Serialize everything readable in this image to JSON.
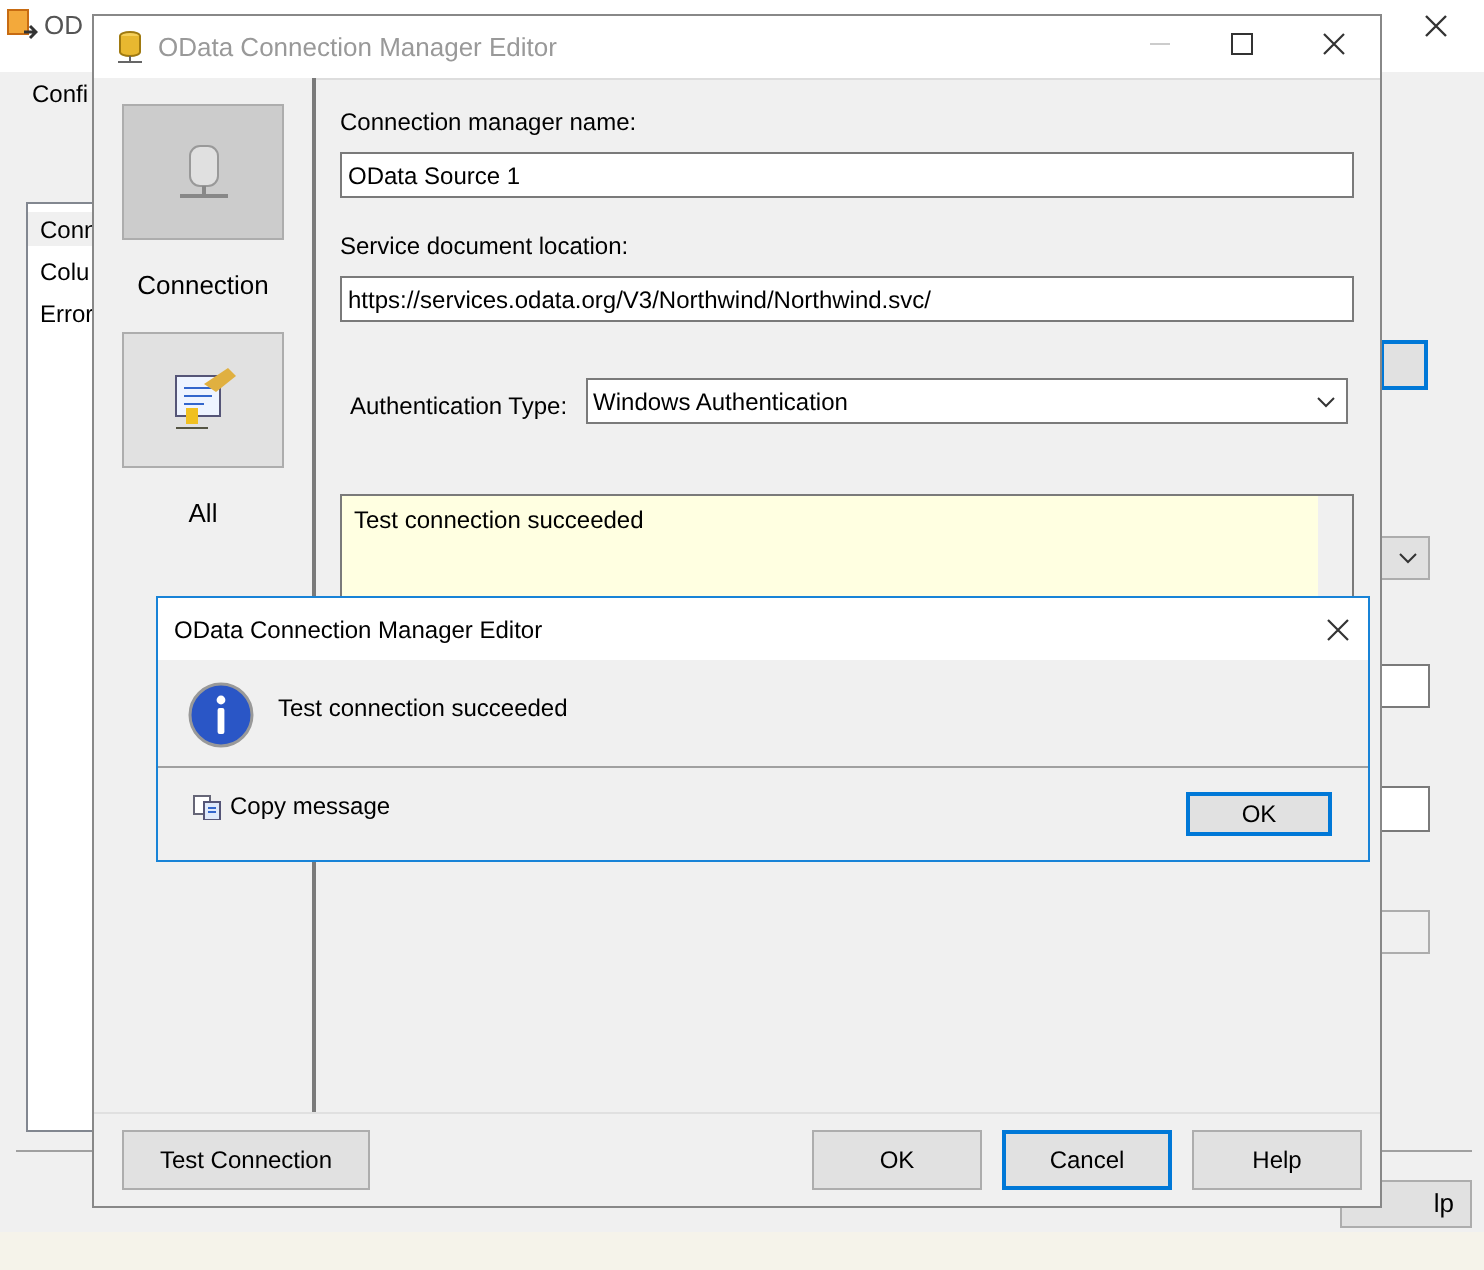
{
  "background_window": {
    "title": "OD",
    "section_label": "Confi",
    "list_items": [
      {
        "label": "Conn",
        "selected": true
      },
      {
        "label": "Colu",
        "selected": false
      },
      {
        "label": "Error",
        "selected": false
      }
    ],
    "help_button": "lp"
  },
  "editor": {
    "title": "OData Connection Manager Editor",
    "pages": [
      {
        "label": "Connection",
        "selected": true
      },
      {
        "label": "All",
        "selected": false
      }
    ],
    "connection_manager_name": {
      "label": "Connection manager name:",
      "value": "OData Source 1"
    },
    "service_document_location": {
      "label": "Service document location:",
      "value": "https://services.odata.org/V3/Northwind/Northwind.svc/"
    },
    "authentication_type": {
      "label": "Authentication Type:",
      "value": "Windows Authentication"
    },
    "status_text": "Test connection succeeded",
    "buttons": [
      {
        "label": "Test Connection",
        "focused": false
      },
      {
        "label": "OK",
        "focused": false
      },
      {
        "label": "Cancel",
        "focused": true
      },
      {
        "label": "Help",
        "focused": false
      }
    ]
  },
  "message_box": {
    "title": "OData Connection Manager Editor",
    "message": "Test connection succeeded",
    "copy_link": "Copy message",
    "ok_button": {
      "label": "OK",
      "focused": true
    }
  }
}
